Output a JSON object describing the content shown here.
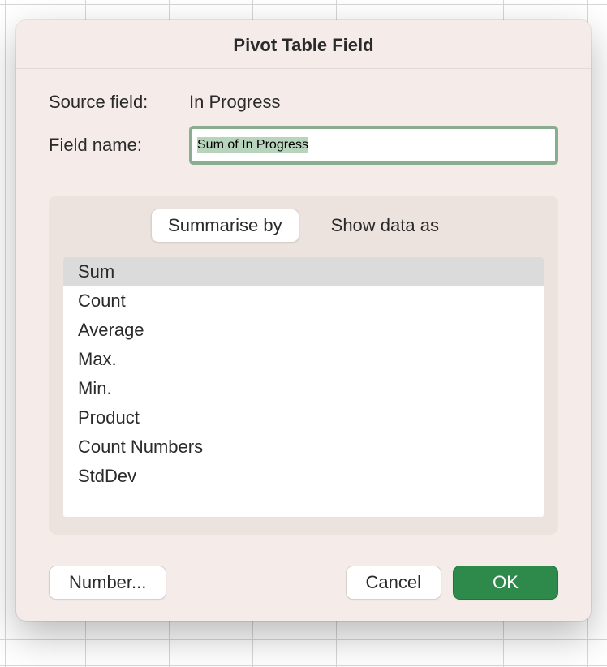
{
  "dialog": {
    "title": "Pivot Table Field",
    "source_field_label": "Source field:",
    "source_field_value": "In Progress",
    "field_name_label": "Field name:",
    "field_name_value": "Sum of In Progress",
    "tabs": {
      "summarise_label": "Summarise by",
      "show_data_label": "Show data as",
      "active": "summarise"
    },
    "summarise_options": [
      "Sum",
      "Count",
      "Average",
      "Max.",
      "Min.",
      "Product",
      "Count Numbers",
      "StdDev"
    ],
    "selected_option": "Sum",
    "buttons": {
      "number": "Number...",
      "cancel": "Cancel",
      "ok": "OK"
    }
  }
}
